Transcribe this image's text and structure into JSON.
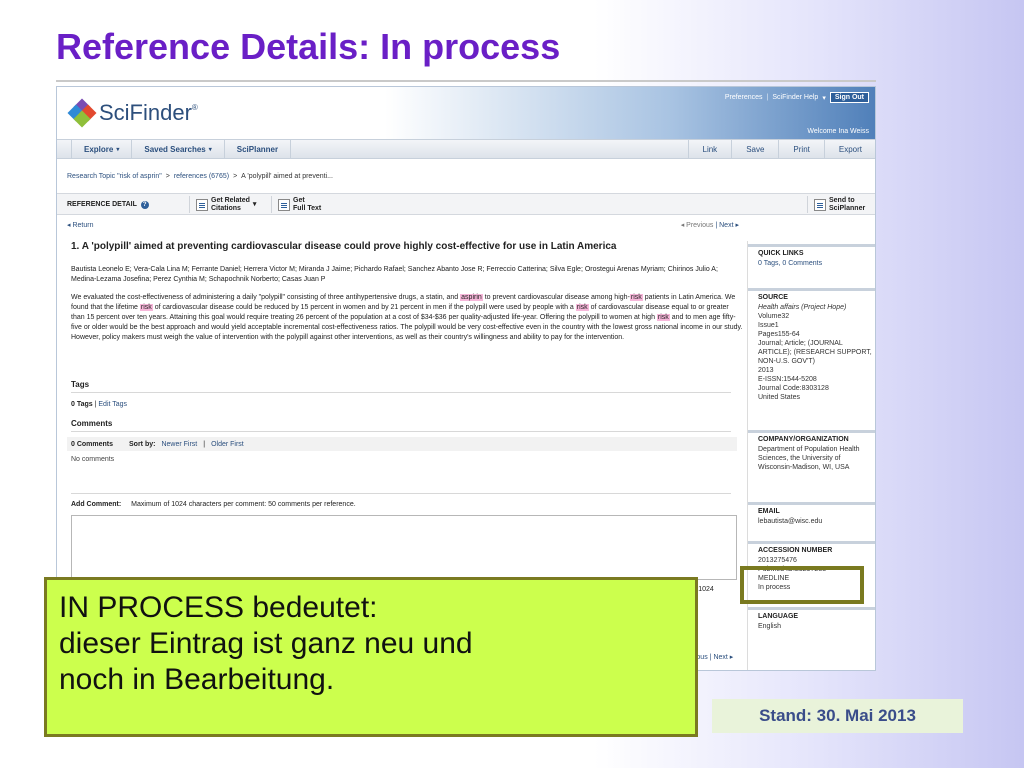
{
  "slide": {
    "title": "Reference Details: In process",
    "callout": {
      "line1": "IN PROCESS bedeutet:",
      "line2": "dieser Eintrag ist ganz neu und",
      "line3": "noch in Bearbeitung."
    },
    "stand": "Stand: 30. Mai 2013"
  },
  "header": {
    "logo_text": "SciFinder",
    "logo_reg": "®",
    "preferences": "Preferences",
    "help": "SciFinder Help",
    "help_caret": "▾",
    "separator": "|",
    "signout": "Sign Out",
    "welcome": "Welcome Ina Weiss"
  },
  "nav": {
    "explore": "Explore",
    "saved_searches": "Saved Searches",
    "sciplanner": "SciPlanner",
    "caret": "▾",
    "link": "Link",
    "save": "Save",
    "print": "Print",
    "export": "Export"
  },
  "breadcrumb": {
    "item1": "Research Topic \"risk of asprin\"",
    "item2": "references (6765)",
    "item3": "A 'polypill' aimed at preventi...",
    "sep": ">"
  },
  "toolbar": {
    "title": "REFERENCE DETAIL",
    "help": "?",
    "get_related": "Get Related",
    "citations": "Citations",
    "get": "Get",
    "full_text": "Full Text",
    "send_to": "Send to",
    "sciplanner": "SciPlanner",
    "caret": "▾"
  },
  "paging": {
    "return": "Return",
    "return_arrow": "◂",
    "previous": "Previous",
    "next": "Next",
    "sep": "|",
    "prev_arrow": "◂",
    "next_arrow": "▸"
  },
  "reference": {
    "title": "1.  A 'polypill' aimed at preventing cardiovascular disease could prove highly cost-effective for use in Latin America",
    "authors": "Bautista Leonelo E; Vera-Cala Lina M; Ferrante Daniel; Herrera Victor M; Miranda J Jaime; Pichardo Rafael; Sanchez Abanto Jose R; Ferreccio Catterina; Silva Egle; Orostegui Arenas Myriam; Chirinos Julio A; Medina-Lezama Josefina; Perez Cynthia M; Schapochnik Norberto; Casas Juan P",
    "abstract": {
      "p1": "We evaluated the cost-effectiveness of administering a daily \"polypill\" consisting of three antihypertensive drugs, a statin, and ",
      "hl1": "aspirin",
      "p2": " to prevent cardiovascular disease among high-",
      "hl2": "risk",
      "p3": " patients in Latin America.  We found that the lifetime ",
      "hl3": "risk",
      "p4": " of cardiovascular disease could be reduced by 15 percent in women and by 21 percent in men if the polypill were used by people with a ",
      "hl4": "risk",
      "p5": " of cardiovascular disease equal to or greater than 15 percent over ten years.  Attaining this goal would require treating 26 percent of the population at a cost of $34-$36 per quality-adjusted life-year.  Offering the polypill to women at high ",
      "hl5": "risk",
      "p6": " and to men age fifty-five or older would be the best approach and would yield acceptable incremental cost-effectiveness ratios.  The polypill would be very cost-effective even in the country with the lowest gross national income in our study.  However, policy makers must weigh the value of intervention with the polypill against other interventions, as well as their country's willingness and ability to pay for the intervention."
    }
  },
  "tags": {
    "heading": "Tags",
    "count": "0 Tags",
    "sep": "|",
    "edit": "Edit Tags"
  },
  "comments": {
    "heading": "Comments",
    "count": "0 Comments",
    "sort_by": "Sort by:",
    "newer": "Newer First",
    "sep": "|",
    "older": "Older First",
    "empty": "No comments",
    "add_label": "Add Comment:",
    "limit": "Maximum of 1024 characters per comment: 50 comments per reference.",
    "partial": "ing:  1024"
  },
  "sidebar": {
    "quick_links": {
      "heading": "QUICK LINKS",
      "value": "0 Tags, 0 Comments"
    },
    "source": {
      "heading": "SOURCE",
      "journal": "Health affairs (Project Hope)",
      "lines": "Volume32\nIssue1\nPages155-64\nJournal; Article; (JOURNAL ARTICLE); (RESEARCH SUPPORT, NON-U.S. GOV'T)\n2013\nE-ISSN:1544-5208\nJournal Code:8303128\nUnited States"
    },
    "company": {
      "heading": "COMPANY/ORGANIZATION",
      "value": "Department of Population Health Sciences, the University of Wisconsin-Madison, WI, USA"
    },
    "email": {
      "heading": "EMAIL",
      "value": "lebautista@wisc.edu"
    },
    "accession": {
      "heading": "ACCESSION NUMBER",
      "lines": "2013275476\nPubMed ID:23297283\nMEDLINE\nIn process"
    },
    "language": {
      "heading": "LANGUAGE",
      "value": "English"
    }
  },
  "colors": {
    "title": "#6a1fc6",
    "callout_bg": "#ccff4d",
    "callout_border": "#7a7a20",
    "highlight": "#f7b7da",
    "link": "#2b4f7e"
  }
}
